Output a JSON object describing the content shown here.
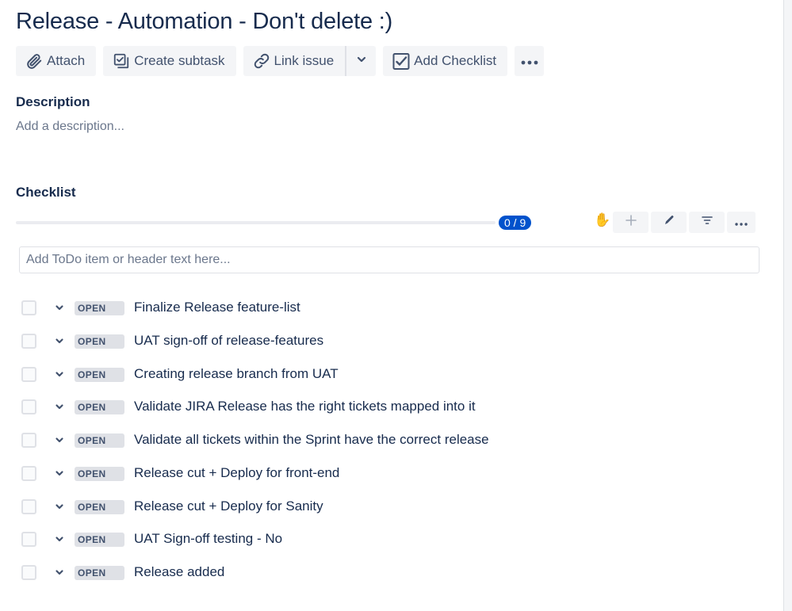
{
  "issue": {
    "title": "Release - Automation - Don't delete :)"
  },
  "toolbar": {
    "attach_label": "Attach",
    "create_subtask_label": "Create subtask",
    "link_issue_label": "Link issue",
    "add_checklist_label": "Add Checklist"
  },
  "description": {
    "heading": "Description",
    "placeholder": "Add a description..."
  },
  "checklist": {
    "heading": "Checklist",
    "progress_text": "0 / 9",
    "progress_fraction": 0,
    "hand_icon": "✋",
    "add_placeholder": "Add ToDo item or header text here...",
    "accent_color": "#0052cc",
    "items": [
      {
        "status": "OPEN",
        "text": "Finalize Release feature-list"
      },
      {
        "status": "OPEN",
        "text": "UAT sign-off of release-features"
      },
      {
        "status": "OPEN",
        "text": "Creating release branch from UAT"
      },
      {
        "status": "OPEN",
        "text": "Validate JIRA Release has the right tickets mapped into it"
      },
      {
        "status": "OPEN",
        "text": "Validate all tickets within the Sprint have the correct release"
      },
      {
        "status": "OPEN",
        "text": "Release cut + Deploy for front-end"
      },
      {
        "status": "OPEN",
        "text": "Release cut + Deploy for Sanity"
      },
      {
        "status": "OPEN",
        "text": "UAT Sign-off testing - No"
      },
      {
        "status": "OPEN",
        "text": "Release added"
      }
    ]
  }
}
